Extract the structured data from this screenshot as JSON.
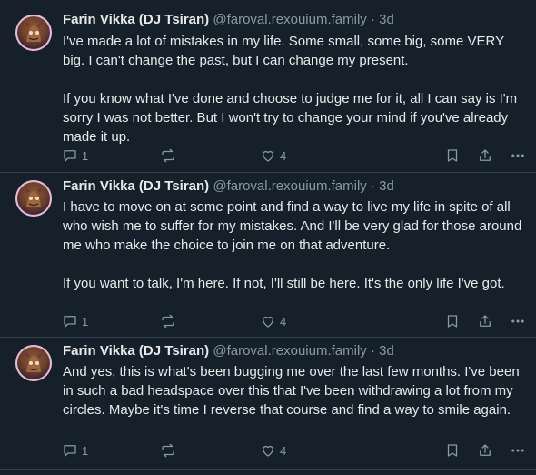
{
  "posts": [
    {
      "author_name": "Farin Vikka (DJ Tsiran)",
      "handle": "@faroval.rexouium.family",
      "separator": "·",
      "time": "3d",
      "paragraphs": [
        "I've made a lot of mistakes in my life. Some small, some big, some VERY big. I can't change the past, but I can change my present.",
        "If you know what I've done and choose to judge me for it, all I can say is I'm sorry I was not better. But I won't try to change your mind if you've already made it up."
      ],
      "reply_count": "1",
      "like_count": "4"
    },
    {
      "author_name": "Farin Vikka (DJ Tsiran)",
      "handle": "@faroval.rexouium.family",
      "separator": "·",
      "time": "3d",
      "paragraphs": [
        "I have to move on at some point and find a way to live my life in spite of all who wish me to suffer for my mistakes. And I'll be very glad for those around me who make the choice to join me on that adventure.",
        "If you want to talk, I'm here. If not, I'll still be here. It's the only life I've got."
      ],
      "reply_count": "1",
      "like_count": "4"
    },
    {
      "author_name": "Farin Vikka (DJ Tsiran)",
      "handle": "@faroval.rexouium.family",
      "separator": "·",
      "time": "3d",
      "paragraphs": [
        "And yes, this is what's been bugging me over the last few months. I've been in such a bad headspace over this that I've been withdrawing a lot from my circles. Maybe it's time I reverse that course and find a way to smile again."
      ],
      "reply_count": "1",
      "like_count": "4"
    }
  ],
  "icons": {
    "reply": "reply-icon",
    "repost": "repost-icon",
    "like": "heart-icon",
    "bookmark": "bookmark-icon",
    "share": "share-icon",
    "more": "more-icon"
  },
  "colors": {
    "background": "#15202b",
    "text": "#e7e9ea",
    "muted": "#8b98a5",
    "divider": "#38444d"
  }
}
